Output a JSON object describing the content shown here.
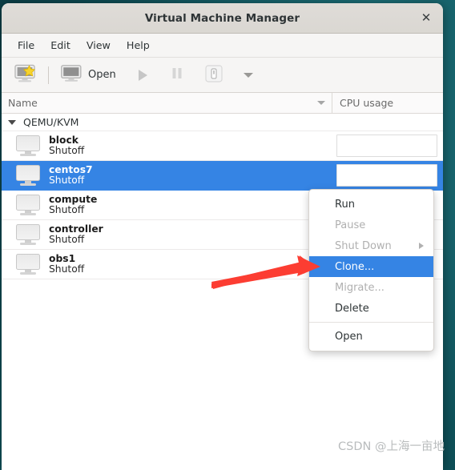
{
  "window": {
    "title": "Virtual Machine Manager",
    "close_icon": "close-icon"
  },
  "menubar": {
    "items": [
      {
        "label": "File"
      },
      {
        "label": "Edit"
      },
      {
        "label": "View"
      },
      {
        "label": "Help"
      }
    ]
  },
  "toolbar": {
    "new_vm_icon": "new-vm-icon",
    "open_label": "Open",
    "open_icon": "monitor-icon",
    "run_icon": "play-icon",
    "pause_icon": "pause-icon",
    "shutdown_icon": "power-icon",
    "menu_caret_icon": "chevron-down-icon"
  },
  "columns": {
    "name": "Name",
    "cpu_usage": "CPU usage",
    "sort_caret_icon": "chevron-down-icon"
  },
  "group": {
    "label": "QEMU/KVM",
    "expander_icon": "chevron-down-icon"
  },
  "vms": [
    {
      "name": "block",
      "state": "Shutoff",
      "selected": false,
      "icon": "monitor-icon",
      "has_graph": true
    },
    {
      "name": "centos7",
      "state": "Shutoff",
      "selected": true,
      "icon": "monitor-icon",
      "has_graph": true
    },
    {
      "name": "compute",
      "state": "Shutoff",
      "selected": false,
      "icon": "monitor-icon",
      "has_graph": false
    },
    {
      "name": "controller",
      "state": "Shutoff",
      "selected": false,
      "icon": "monitor-icon",
      "has_graph": false
    },
    {
      "name": "obs1",
      "state": "Shutoff",
      "selected": false,
      "icon": "monitor-icon",
      "has_graph": false
    }
  ],
  "context_menu": {
    "items": [
      {
        "label": "Run",
        "state": "normal"
      },
      {
        "label": "Pause",
        "state": "disabled"
      },
      {
        "label": "Shut Down",
        "state": "disabled",
        "submenu": true
      },
      {
        "label": "Clone...",
        "state": "highlight"
      },
      {
        "label": "Migrate...",
        "state": "disabled"
      },
      {
        "label": "Delete",
        "state": "normal"
      },
      {
        "separator": true
      },
      {
        "label": "Open",
        "state": "normal"
      }
    ]
  },
  "annotation": {
    "arrow_color": "#fc3d32",
    "target": "Clone..."
  },
  "watermark": {
    "text": "CSDN @上海一亩地"
  },
  "colors": {
    "selection_blue": "#3584e4",
    "titlebar": "#dad7d2",
    "toolbar": "#f6f5f4",
    "desktop": "#125b64"
  }
}
